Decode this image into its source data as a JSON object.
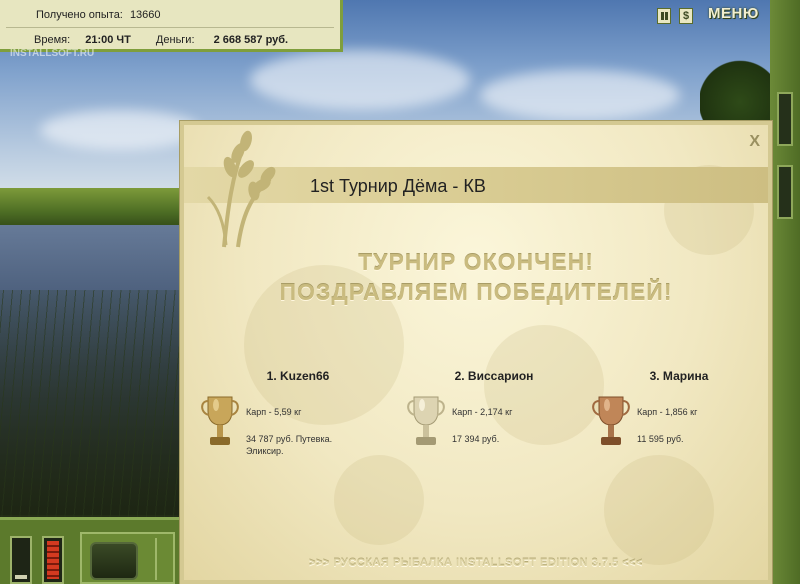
{
  "hud": {
    "experience_label": "Получено опыта:",
    "experience_value": "13660",
    "time_label": "Время:",
    "time_value": "21:00 ЧТ",
    "money_label": "Деньги:",
    "money_value": "2 668 587 руб."
  },
  "watermark": "INSTALLSOFT.RU",
  "controls": {
    "pause_icon": "pause-icon",
    "sound_label": "$",
    "menu_label": "МЕНЮ"
  },
  "gauges": {
    "left_level": 0.1,
    "right_level": 1.0,
    "right_color": "#d33a20"
  },
  "modal": {
    "close_label": "X",
    "tournament_title": "1st Турнир Дёма - КВ",
    "headline_line1": "ТУРНИР ОКОНЧЕН!",
    "headline_line2": "ПОЗДРАВЛЯЕМ ПОБЕДИТЕЛЕЙ!",
    "winners": [
      {
        "name": "1. Kuzen66",
        "catch": "Карп - 5,59 кг",
        "prize": "34 787 руб. Путевка. Эликсир.",
        "cup": "gold-cup-icon",
        "cup_color": "#c8a65a"
      },
      {
        "name": "2. Виссарион",
        "catch": "Карп - 2,174 кг",
        "prize": "17 394 руб.",
        "cup": "silver-cup-icon",
        "cup_color": "#d8cfae"
      },
      {
        "name": "3. Марина",
        "catch": "Карп - 1,856 кг",
        "prize": "11 595 руб.",
        "cup": "bronze-cup-icon",
        "cup_color": "#c08658"
      }
    ],
    "footer": ">>> РУССКАЯ РЫБАЛКА INSTALLSOFT EDITION 3.7.5 <<<"
  },
  "colors": {
    "frame_green": "#7f9e3c",
    "hud_bg": "#e7e6c0",
    "parchment": "#f1e8c2"
  }
}
